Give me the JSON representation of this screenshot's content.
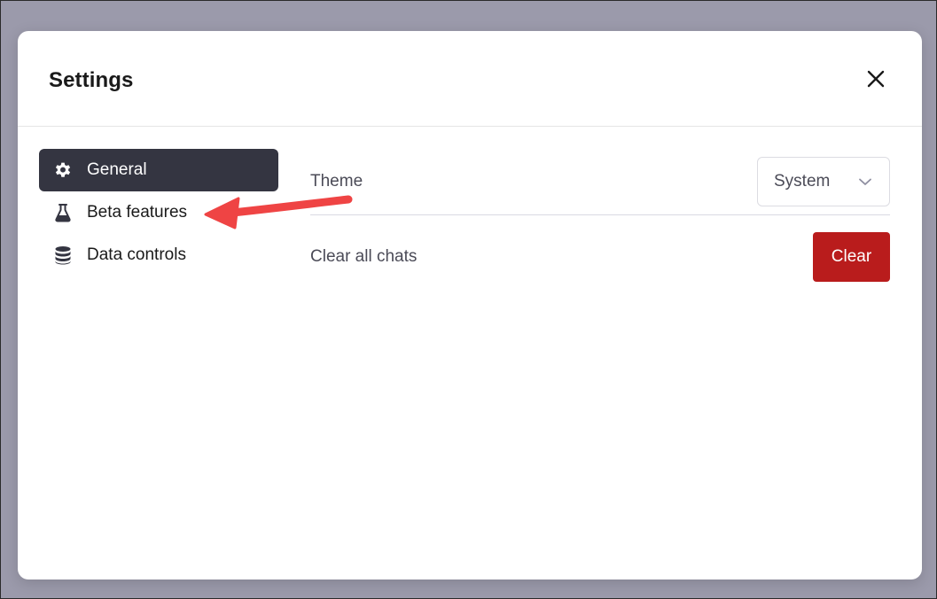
{
  "modal": {
    "title": "Settings",
    "close_icon": "close-icon"
  },
  "sidebar": {
    "items": [
      {
        "label": "General",
        "icon": "gear-icon",
        "active": true
      },
      {
        "label": "Beta features",
        "icon": "flask-icon",
        "active": false
      },
      {
        "label": "Data controls",
        "icon": "database-icon",
        "active": false
      }
    ]
  },
  "general": {
    "theme_label": "Theme",
    "theme_value": "System",
    "clear_label": "Clear all chats",
    "clear_button": "Clear"
  },
  "annotation": {
    "arrow_color": "#ef4444",
    "points_to": "Beta features"
  },
  "colors": {
    "active_bg": "#343541",
    "danger": "#b91c1c",
    "overlay": "#9b9aab"
  }
}
